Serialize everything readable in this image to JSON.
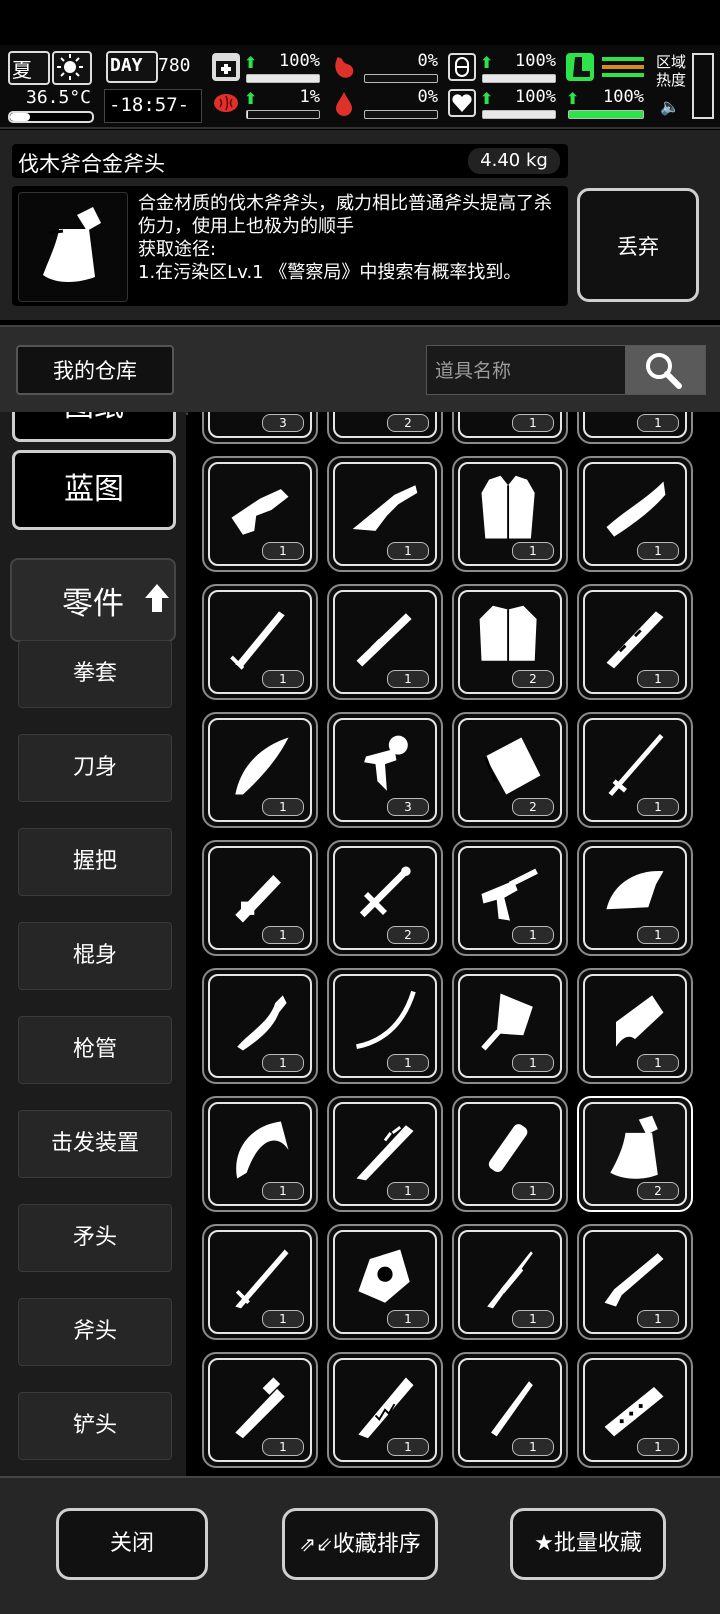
{
  "status": {
    "season": "夏",
    "temperature": "36.5°C",
    "day_label": "DAY",
    "day_count": "780",
    "clock": "-18:57-",
    "health": "100%",
    "hunger": "0%",
    "armor": "100%",
    "mental": "1%",
    "blood": "0%",
    "mood": "100%",
    "stamina": "100%",
    "area_heat": "区域\n热度"
  },
  "item": {
    "name": "伐木斧合金斧头",
    "weight": "4.40 kg",
    "description": "合金材质的伐木斧斧头，威力相比普通斧头提高了杀伤力，使用上也极为的顺手\n获取途径:\n1.在污染区Lv.1 《警察局》中搜索有概率找到。",
    "discard_label": "丢弃"
  },
  "warehouse": {
    "label": "我的仓库",
    "search_placeholder": "道具名称"
  },
  "sidebar": {
    "top_partial": "图纸",
    "blueprint": "蓝图",
    "parts": "零件",
    "subs": [
      "拳套",
      "刀身",
      "握把",
      "棍身",
      "枪管",
      "击发装置",
      "矛头",
      "斧头",
      "铲头"
    ]
  },
  "grid": {
    "top_counts": [
      "3",
      "2",
      "1",
      "1"
    ],
    "rows": [
      [
        {
          "icon": "gun-stock-icon",
          "count": "1"
        },
        {
          "icon": "submachine-gun-icon",
          "count": "1"
        },
        {
          "icon": "vest-icon",
          "count": "1"
        },
        {
          "icon": "blade-fragment-icon",
          "count": "1"
        }
      ],
      [
        {
          "icon": "sword-blade-icon",
          "count": "1"
        },
        {
          "icon": "barrel-icon",
          "count": "1"
        },
        {
          "icon": "jacket-icon",
          "count": "2"
        },
        {
          "icon": "ornate-stick-icon",
          "count": "1"
        }
      ],
      [
        {
          "icon": "curved-blade-icon",
          "count": "1"
        },
        {
          "icon": "trigger-icon",
          "count": "3"
        },
        {
          "icon": "cleaver-head-icon",
          "count": "2"
        },
        {
          "icon": "thin-sword-icon",
          "count": "1"
        }
      ],
      [
        {
          "icon": "rifle-part-icon",
          "count": "1"
        },
        {
          "icon": "valve-pipe-icon",
          "count": "2"
        },
        {
          "icon": "firing-pin-icon",
          "count": "1"
        },
        {
          "icon": "iron-head-icon",
          "count": "1"
        }
      ],
      [
        {
          "icon": "hook-handle-icon",
          "count": "1"
        },
        {
          "icon": "bow-limb-icon",
          "count": "1"
        },
        {
          "icon": "shovel-head-icon",
          "count": "1"
        },
        {
          "icon": "claw-blade-icon",
          "count": "1"
        }
      ],
      [
        {
          "icon": "pickaxe-icon",
          "count": "1"
        },
        {
          "icon": "spiked-club-icon",
          "count": "1"
        },
        {
          "icon": "tube-icon",
          "count": "1"
        },
        {
          "icon": "axe-head-icon",
          "count": "2",
          "selected": true
        }
      ],
      [
        {
          "icon": "serrated-spear-icon",
          "count": "1"
        },
        {
          "icon": "armor-plate-icon",
          "count": "1"
        },
        {
          "icon": "dagger-icon",
          "count": "1"
        },
        {
          "icon": "shotgun-icon",
          "count": "1"
        }
      ],
      [
        {
          "icon": "scope-barrel-icon",
          "count": "1"
        },
        {
          "icon": "jagged-blade-icon",
          "count": "1"
        },
        {
          "icon": "spear-tip-icon",
          "count": "1"
        },
        {
          "icon": "rail-mount-icon",
          "count": "1"
        }
      ]
    ]
  },
  "footer": {
    "close": "关闭",
    "sort": "收藏排序",
    "batch": "批量收藏"
  }
}
